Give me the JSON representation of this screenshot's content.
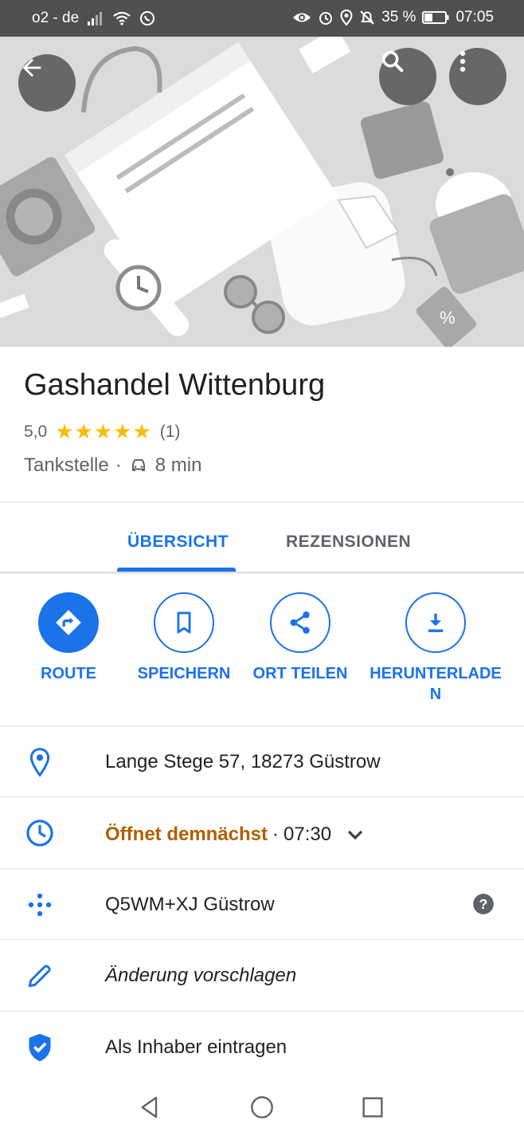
{
  "status_bar": {
    "carrier": "o2 - de",
    "battery": "35 %",
    "time": "07:05"
  },
  "place": {
    "name": "Gashandel Wittenburg",
    "rating": "5,0",
    "stars": "★★★★★",
    "review_count": "(1)",
    "category": "Tankstelle",
    "separator": "·",
    "drive_time": "8 min"
  },
  "tabs": [
    {
      "label": "ÜBERSICHT",
      "active": true
    },
    {
      "label": "REZENSIONEN",
      "active": false
    }
  ],
  "actions": [
    {
      "label": "ROUTE",
      "icon": "directions-icon"
    },
    {
      "label": "SPEICHERN",
      "icon": "bookmark-icon"
    },
    {
      "label": "ORT TEILEN",
      "icon": "share-icon"
    },
    {
      "label": "HERUNTERLADE\nN",
      "icon": "download-icon"
    }
  ],
  "info": {
    "address": "Lange Stege 57, 18273 Güstrow",
    "hours_status": "Öffnet demnächst",
    "hours_separator": "·",
    "hours_time": "07:30",
    "plus_code": "Q5WM+XJ Güstrow",
    "suggest_edit": "Änderung vorschlagen",
    "claim_business": "Als Inhaber eintragen"
  },
  "colors": {
    "accent": "#1a73e8",
    "star": "#fbbc04",
    "hours_status": "#b06000",
    "status_bar": "#505050"
  }
}
